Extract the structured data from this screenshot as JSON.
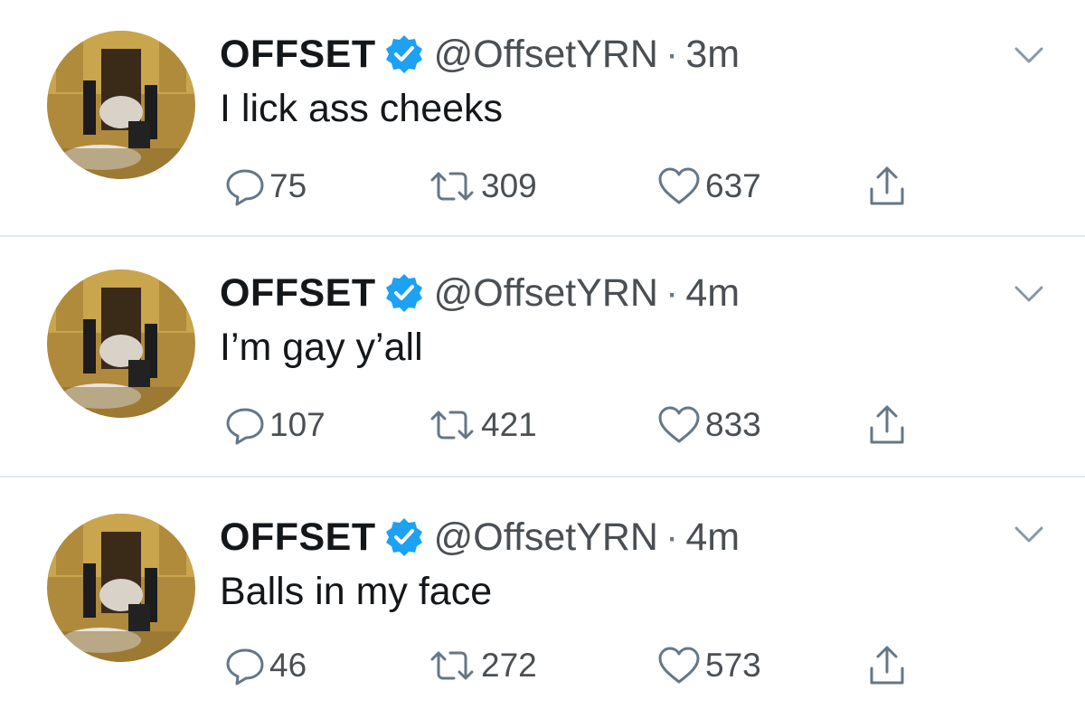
{
  "tweets": [
    {
      "name": "OFFSET",
      "handle": "@OffsetYRN",
      "separator": "·",
      "time": "3m",
      "text": "I lick ass cheeks",
      "replies": "75",
      "retweets": "309",
      "likes": "637"
    },
    {
      "name": "OFFSET",
      "handle": "@OffsetYRN",
      "separator": "·",
      "time": "4m",
      "text": "I’m gay y’all",
      "replies": "107",
      "retweets": "421",
      "likes": "833"
    },
    {
      "name": "OFFSET",
      "handle": "@OffsetYRN",
      "separator": "·",
      "time": "4m",
      "text": "Balls in my face",
      "replies": "46",
      "retweets": "272",
      "likes": "573"
    }
  ],
  "colors": {
    "verified": "#1da1f2",
    "icon": "#657786",
    "text": "#14171a",
    "divider": "#e1e8ed"
  },
  "icons": {
    "reply": "reply-icon",
    "retweet": "retweet-icon",
    "like": "heart-icon",
    "share": "share-icon",
    "verified": "verified-badge-icon",
    "menu": "chevron-down-icon"
  }
}
